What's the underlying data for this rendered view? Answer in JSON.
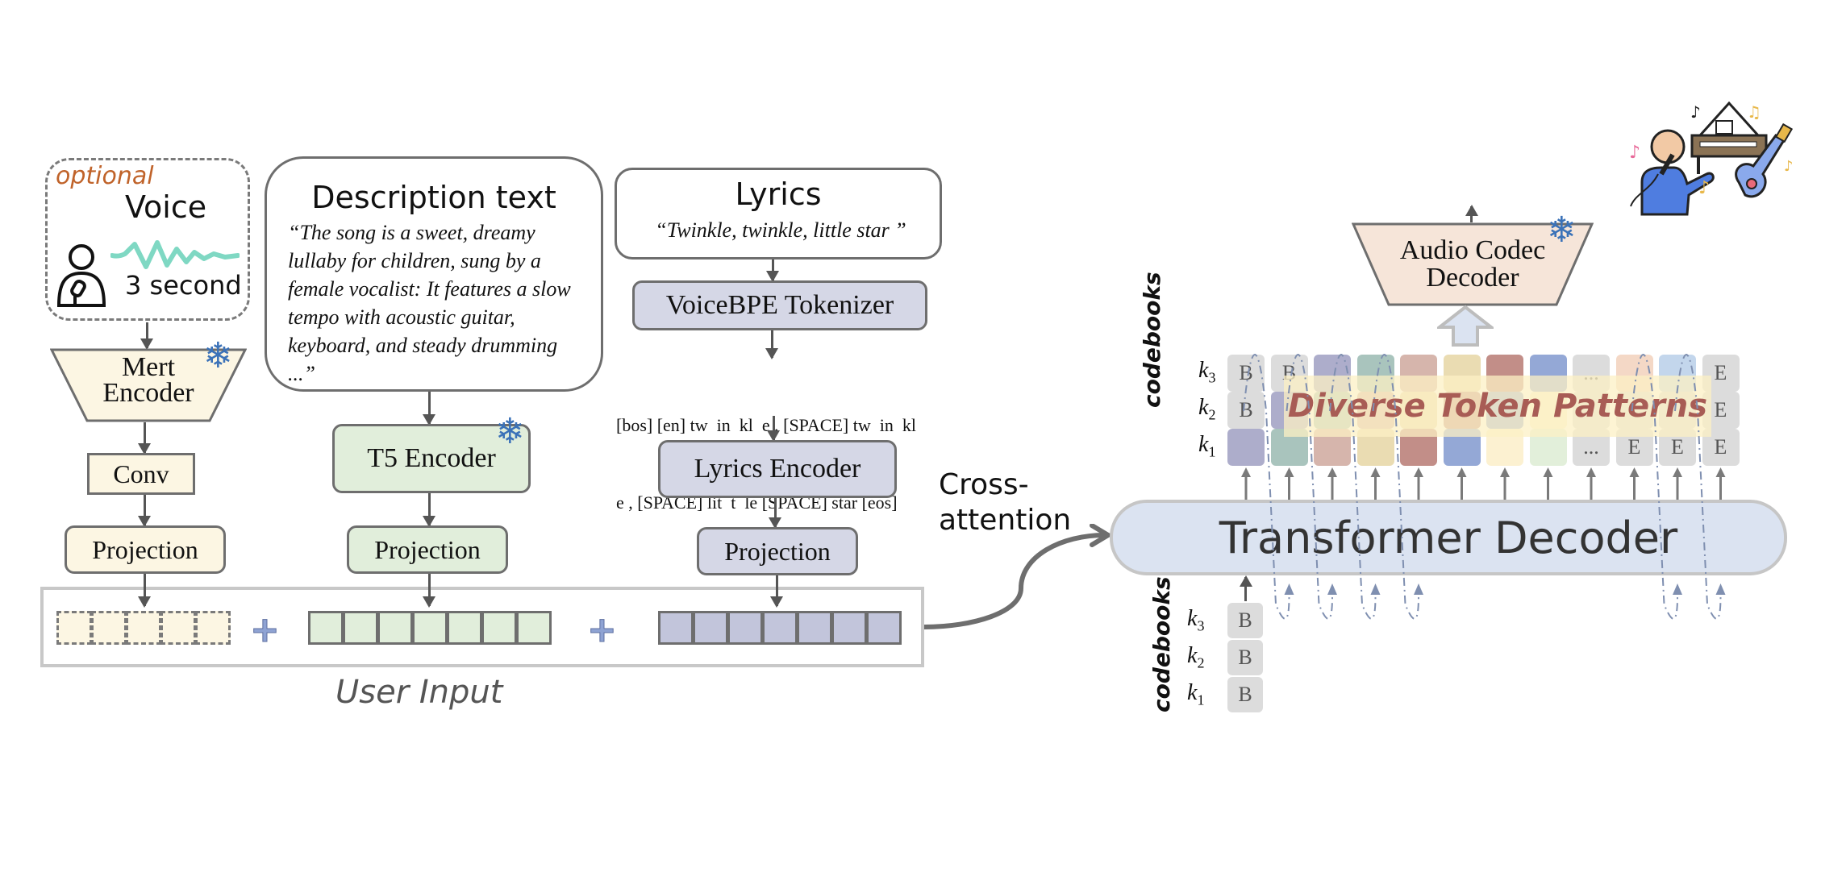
{
  "voice": {
    "optional_label": "optional",
    "title": "Voice",
    "duration": "3 second",
    "icon": "singer-person-icon",
    "wave_icon": "voice-wave-icon"
  },
  "mert_encoder": {
    "line1": "Mert",
    "line2": "Encoder",
    "frozen": true
  },
  "conv": {
    "label": "Conv"
  },
  "voice_projection": {
    "label": "Projection"
  },
  "description": {
    "title": "Description text",
    "text": "“The song is a sweet, dreamy lullaby for children, sung by a female vocalist: It features a slow tempo with acoustic guitar, keyboard, and steady drumming ...”"
  },
  "t5_encoder": {
    "label": "T5 Encoder",
    "frozen": true
  },
  "text_projection": {
    "label": "Projection"
  },
  "lyrics": {
    "title": "Lyrics",
    "text": "“Twinkle, twinkle, little star ”"
  },
  "tokenizer": {
    "label": "VoiceBPE Tokenizer"
  },
  "token_sequence": {
    "line1": "[bos] [en] tw  in  kl  e , [SPACE] tw  in  kl",
    "line2": "e , [SPACE] lit  t  le [SPACE] star [eos]"
  },
  "lyrics_encoder": {
    "label": "Lyrics Encoder"
  },
  "lyrics_projection": {
    "label": "Projection"
  },
  "user_input": {
    "label": "User Input",
    "voice_cells": 5,
    "text_cells": 7,
    "lyrics_cells": 7,
    "plus_symbol": "+"
  },
  "cross_attention": {
    "line1": "Cross-",
    "line2": "attention"
  },
  "transformer_decoder": {
    "label": "Transformer Decoder"
  },
  "audio_codec_decoder": {
    "line1": "Audio Codec",
    "line2": "Decoder",
    "frozen": true
  },
  "output": {
    "waveform_icon": "colorful-waveform-icon",
    "music_icon": "singer-piano-guitar-icon"
  },
  "codebooks": {
    "axis_label": "codebooks",
    "rows": [
      "k3",
      "k2",
      "k1"
    ],
    "row_labels": [
      {
        "k": "k",
        "sub": "3"
      },
      {
        "k": "k",
        "sub": "2"
      },
      {
        "k": "k",
        "sub": "1"
      }
    ],
    "overlay_label": "Diverse Token Patterns",
    "grid": [
      [
        {
          "t": "B",
          "c": "#dcdcdc"
        },
        {
          "t": "B",
          "c": "#dcdcdc"
        },
        {
          "t": "",
          "c": "#adadcb"
        },
        {
          "t": "",
          "c": "#a9c4bd"
        },
        {
          "t": "",
          "c": "#d6b5ac"
        },
        {
          "t": "",
          "c": "#eadcb2"
        },
        {
          "t": "",
          "c": "#c28e88"
        },
        {
          "t": "",
          "c": "#94a8d6"
        },
        {
          "t": "...",
          "c": "#dcdcdc"
        },
        {
          "t": "",
          "c": "#f4d8c6"
        },
        {
          "t": "",
          "c": "#c3d6ec"
        },
        {
          "t": "E",
          "c": "#dcdcdc"
        }
      ],
      [
        {
          "t": "B",
          "c": "#dcdcdc"
        },
        {
          "t": "",
          "c": "#adadcb"
        },
        {
          "t": "",
          "c": "#a9c4bd"
        },
        {
          "t": "",
          "c": "#d6b5ac"
        },
        {
          "t": "",
          "c": "#eadcb2"
        },
        {
          "t": "",
          "c": "#c28e88"
        },
        {
          "t": "",
          "c": "#94a8d6"
        },
        {
          "t": "",
          "c": "#fcf1d1"
        },
        {
          "t": "",
          "c": "#dcdcdc"
        },
        {
          "t": "",
          "c": "#dcdcdc"
        },
        {
          "t": "",
          "c": "#dcdcdc"
        },
        {
          "t": "E",
          "c": "#dcdcdc"
        }
      ],
      [
        {
          "t": "",
          "c": "#adadcb"
        },
        {
          "t": "",
          "c": "#a9c4bd"
        },
        {
          "t": "",
          "c": "#d6b5ac"
        },
        {
          "t": "",
          "c": "#eadcb2"
        },
        {
          "t": "",
          "c": "#c28e88"
        },
        {
          "t": "",
          "c": "#94a8d6"
        },
        {
          "t": "",
          "c": "#fcf1d1"
        },
        {
          "t": "",
          "c": "#e2efda"
        },
        {
          "t": "...",
          "c": "#dcdcdc"
        },
        {
          "t": "E",
          "c": "#dcdcdc"
        },
        {
          "t": "E",
          "c": "#dcdcdc"
        },
        {
          "t": "E",
          "c": "#dcdcdc"
        }
      ]
    ],
    "input_rows": [
      {
        "t": "B"
      },
      {
        "t": "B"
      },
      {
        "t": "B"
      }
    ]
  },
  "colors": {
    "voice_fill": "#fcf6e3",
    "text_fill": "#e1eedb",
    "lyrics_fill": "#d5d7e6",
    "decoder_fill": "#dbe3f1",
    "codec_fill": "#f6e5d9",
    "optional_text": "#c0632a",
    "overlay_text": "#a85c55",
    "snowflake": "#3b72b8"
  }
}
